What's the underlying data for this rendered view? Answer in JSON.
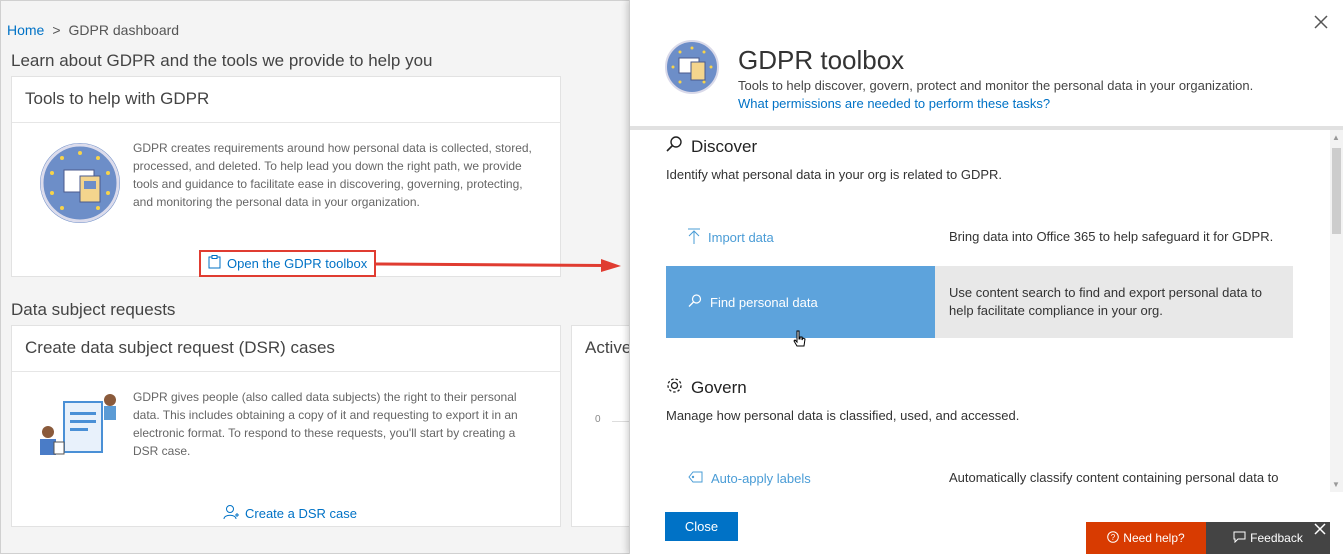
{
  "breadcrumb": {
    "home": "Home",
    "sep": ">",
    "current": "GDPR dashboard"
  },
  "left": {
    "learn_title": "Learn about GDPR and the tools we provide to help you",
    "tools_card": {
      "title": "Tools to help with GDPR",
      "text": "GDPR creates requirements around how personal data is collected, stored, processed, and deleted. To help lead you down the right path, we provide tools and guidance to facilitate ease in discovering, governing, protecting, and monitoring the personal data in your organization.",
      "link": "Open the GDPR toolbox"
    },
    "dsr_title": "Data subject requests",
    "dsr_card": {
      "title": "Create data subject request (DSR) cases",
      "text": "GDPR gives people (also called data subjects) the right to their personal data. This includes obtaining a copy of it and requesting to export it in an electronic format. To respond to these requests, you'll start by creating a DSR case.",
      "link": "Create a DSR case"
    },
    "active_card": {
      "title": "Active",
      "axis_zero": "0"
    }
  },
  "panel": {
    "title": "GDPR toolbox",
    "subtitle": "Tools to help discover, govern, protect and monitor the personal data in your organization.",
    "permissions_link": "What permissions are needed to perform these tasks?",
    "discover": {
      "title": "Discover",
      "description": "Identify what personal data in your org is related to GDPR.",
      "rows": [
        {
          "label": "Import data",
          "desc": "Bring data into Office 365 to help safeguard it for GDPR."
        },
        {
          "label": "Find personal data",
          "desc": "Use content search to find and export personal data to help facilitate compliance in your org."
        }
      ]
    },
    "govern": {
      "title": "Govern",
      "description": "Manage how personal data is classified, used, and accessed.",
      "rows": [
        {
          "label": "Auto-apply labels",
          "desc": "Automatically classify content containing personal data to"
        }
      ]
    },
    "close_button": "Close"
  },
  "footer": {
    "need_help": "Need help?",
    "feedback": "Feedback"
  },
  "colors": {
    "accent": "#0072c6",
    "highlight": "#e03c31",
    "selected": "#5da3dc",
    "help": "#d83b01"
  }
}
